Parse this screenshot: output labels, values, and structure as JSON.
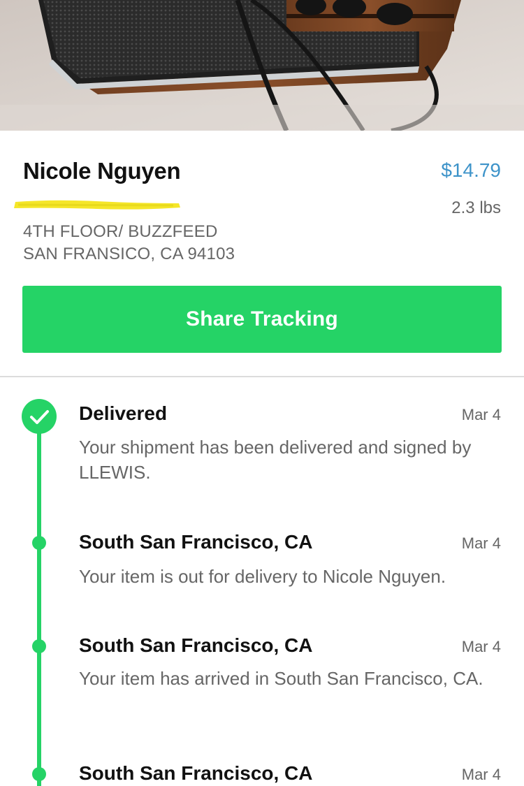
{
  "shipment": {
    "recipient": "Nicole Nguyen",
    "price": "$14.79",
    "weight": "2.3 lbs",
    "address_line1": "4TH FLOOR/ BUZZFEED",
    "address_line2": "SAN FRANSICO, CA 94103"
  },
  "actions": {
    "share_label": "Share Tracking"
  },
  "colors": {
    "accent": "#25d366",
    "price": "#3d93c9",
    "redaction": "#f5e629"
  },
  "timeline": [
    {
      "title": "Delivered",
      "date": "Mar 4",
      "description": "Your shipment has been delivered and signed by LLEWIS.",
      "status_icon": "check-icon"
    },
    {
      "title": "South San Francisco, CA",
      "date": "Mar 4",
      "description": "Your item is out for delivery to Nicole Nguyen."
    },
    {
      "title": "South San Francisco, CA",
      "date": "Mar 4",
      "description": "Your item has arrived in South San Francisco, CA."
    },
    {
      "title": "South San Francisco, CA",
      "date": "Mar 4",
      "description": ""
    }
  ]
}
